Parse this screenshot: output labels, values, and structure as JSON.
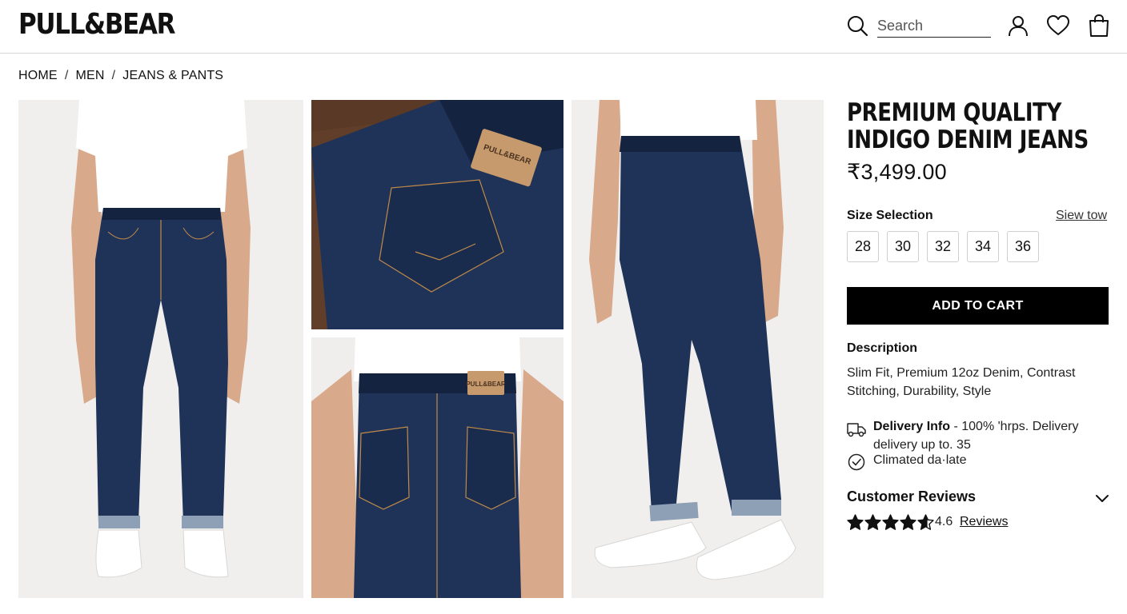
{
  "header": {
    "logo": "PULL&BEAR",
    "search_placeholder": "Search"
  },
  "breadcrumb": [
    "HOME",
    "MEN",
    "JEANS & PANTS"
  ],
  "breadcrumb_separator": "/",
  "gallery": {
    "images": [
      {
        "alt": "Model wearing jeans, front view"
      },
      {
        "alt": "Back pocket and leather label close-up"
      },
      {
        "alt": "Model wearing jeans, back view"
      },
      {
        "alt": "Model wearing jeans, side view"
      }
    ],
    "label_text": "PULL&BEAR"
  },
  "product": {
    "title": "PREMIUM QUALITY INDIGO DENIM JEANS",
    "price": "₹3,499.00",
    "size_label": "Size Selection",
    "size_guide": "Siew tow",
    "sizes": [
      "28",
      "30",
      "32",
      "34",
      "36"
    ],
    "add_to_cart": "ADD TO CART",
    "description_label": "Description",
    "description": "Slim Fit, Premium 12oz Denim, Contrast Stitching, Durability, Style",
    "delivery_label": "Delivery Info",
    "delivery_text": " - 100% 'hrps. Delivery delivery up to. 35",
    "climate_text": "Climated da·late",
    "reviews_title": "Customer Reviews",
    "rating": "4.6",
    "rating_value": 4.6,
    "reviews_link": "Reviews"
  },
  "colors": {
    "denim": "#1f3358",
    "denim_dark": "#14233f",
    "stitch": "#c08a4a",
    "button_bg": "#000000",
    "button_text": "#ffffff"
  }
}
